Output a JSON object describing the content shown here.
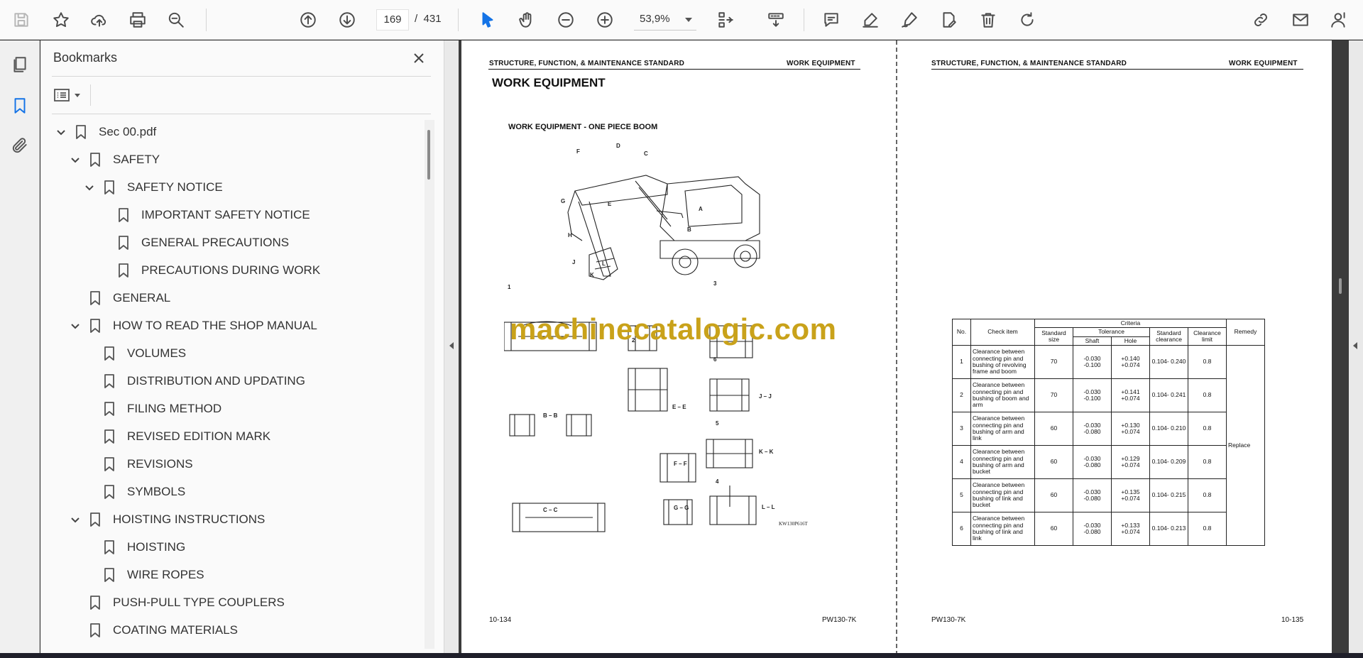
{
  "toolbar": {
    "current_page": "169",
    "page_separator": "/",
    "total_pages": "431",
    "zoom": "53,9%"
  },
  "panel": {
    "title": "Bookmarks"
  },
  "bookmarks": [
    {
      "label": "Sec 00.pdf",
      "level": 0,
      "expanded": true
    },
    {
      "label": "SAFETY",
      "level": 1,
      "expanded": true
    },
    {
      "label": "SAFETY NOTICE",
      "level": 2,
      "expanded": true
    },
    {
      "label": "IMPORTANT SAFETY NOTICE",
      "level": 3
    },
    {
      "label": "GENERAL PRECAUTIONS",
      "level": 3
    },
    {
      "label": "PRECAUTIONS DURING WORK",
      "level": 3
    },
    {
      "label": "GENERAL",
      "level": 1
    },
    {
      "label": "HOW TO READ THE SHOP MANUAL",
      "level": 1,
      "expanded": true
    },
    {
      "label": "VOLUMES",
      "level": 2
    },
    {
      "label": "DISTRIBUTION AND UPDATING",
      "level": 2
    },
    {
      "label": "FILING METHOD",
      "level": 2
    },
    {
      "label": "REVISED EDITION MARK",
      "level": 2
    },
    {
      "label": "REVISIONS",
      "level": 2
    },
    {
      "label": "SYMBOLS",
      "level": 2
    },
    {
      "label": "HOISTING INSTRUCTIONS",
      "level": 1,
      "expanded": true
    },
    {
      "label": "HOISTING",
      "level": 2
    },
    {
      "label": "WIRE ROPES",
      "level": 2
    },
    {
      "label": "PUSH-PULL TYPE COUPLERS",
      "level": 1
    },
    {
      "label": "COATING MATERIALS",
      "level": 1
    }
  ],
  "left_page": {
    "header_left": "STRUCTURE, FUNCTION, & MAINTENANCE STANDARD",
    "header_right": "WORK EQUIPMENT",
    "title": "WORK EQUIPMENT",
    "figure_title": "WORK EQUIPMENT - ONE PIECE BOOM",
    "figure_code": "KW130P616T",
    "section_labels": [
      "B – B",
      "E – E",
      "J – J",
      "F – F",
      "K – K",
      "C – C",
      "G – G",
      "L – L"
    ],
    "point_labels": [
      "D",
      "F",
      "C",
      "G",
      "E",
      "A",
      "H",
      "B",
      "J",
      "K",
      "L"
    ],
    "detail_numbers": [
      "1",
      "2",
      "3",
      "6",
      "5",
      "4"
    ],
    "watermark": "machinecatalogic.com",
    "footer_left": "10-134",
    "footer_right": "PW130-7K"
  },
  "right_page": {
    "header_left": "STRUCTURE, FUNCTION, & MAINTENANCE STANDARD",
    "header_right": "WORK EQUIPMENT",
    "footer_left": "PW130-7K",
    "footer_right": "10-135",
    "table": {
      "h_no": "No.",
      "h_check": "Check item",
      "h_criteria": "Criteria",
      "h_remedy": "Remedy",
      "h_std_size": "Standard size",
      "h_tolerance": "Tolerance",
      "h_shaft": "Shaft",
      "h_hole": "Hole",
      "h_std_clear": "Standard clearance",
      "h_clear_limit": "Clearance limit",
      "remedy": "Replace",
      "rows": [
        {
          "no": "1",
          "item": "Clearance between connecting pin and bushing of revolving frame and boom",
          "size": "70",
          "shaft": "-0.030 -0.100",
          "hole": "+0.140 +0.074",
          "std": "0.104- 0.240",
          "limit": "0.8"
        },
        {
          "no": "2",
          "item": "Clearance between connecting pin and bushing of boom and arm",
          "size": "70",
          "shaft": "-0.030 -0.100",
          "hole": "+0.141 +0.074",
          "std": "0.104- 0.241",
          "limit": "0.8"
        },
        {
          "no": "3",
          "item": "Clearance between connecting pin and bushing of arm and link",
          "size": "60",
          "shaft": "-0.030 -0.080",
          "hole": "+0.130 +0.074",
          "std": "0.104- 0.210",
          "limit": "0.8"
        },
        {
          "no": "4",
          "item": "Clearance between connecting pin and bushing of arm and bucket",
          "size": "60",
          "shaft": "-0.030 -0.080",
          "hole": "+0.129 +0.074",
          "std": "0.104- 0.209",
          "limit": "0.8"
        },
        {
          "no": "5",
          "item": "Clearance between connecting pin and bushing of link and bucket",
          "size": "60",
          "shaft": "-0.030 -0.080",
          "hole": "+0.135 +0.074",
          "std": "0.104- 0.215",
          "limit": "0.8"
        },
        {
          "no": "6",
          "item": "Clearance between connecting pin and bushing of link and link",
          "size": "60",
          "shaft": "-0.030 -0.080",
          "hole": "+0.133 +0.074",
          "std": "0.104- 0.213",
          "limit": "0.8"
        }
      ]
    }
  }
}
